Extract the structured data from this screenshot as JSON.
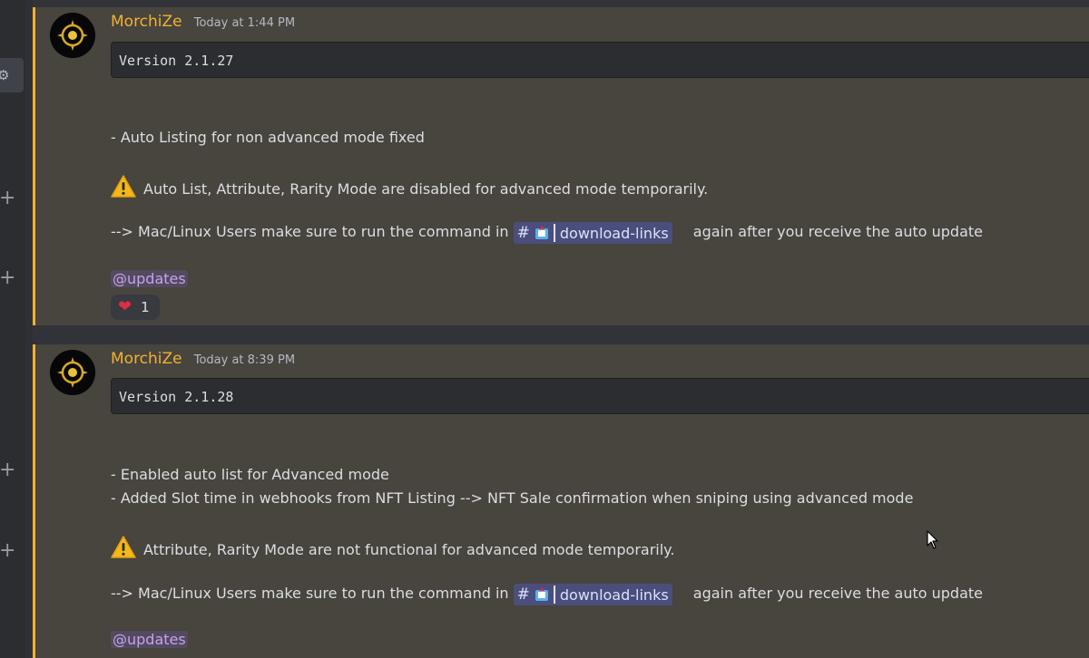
{
  "colors": {
    "accent_name": "#f0b232",
    "highlight_bg": "#48443e",
    "mention": "#c9a0f0",
    "channel_bg": "#4a4e7c"
  },
  "sidebar": {
    "icons": [
      "gear-icon",
      "plus-icon",
      "plus-icon",
      "plus-icon",
      "plus-icon"
    ]
  },
  "messages": [
    {
      "author": "MorchiZe",
      "timestamp": "Today at 1:44 PM",
      "code": "Version 2.1.27",
      "line1": "- Auto Listing for non advanced mode fixed",
      "warning": "Auto List, Attribute, Rarity Mode are disabled for advanced mode temporarily.",
      "cmd_prefix": "--> Mac/Linux Users make sure to run the command in",
      "channel": "download-links",
      "cmd_suffix": "again after you receive the auto update",
      "mention": "@updates",
      "reaction": {
        "emoji": "heart-icon",
        "count": "1"
      }
    },
    {
      "author": "MorchiZe",
      "timestamp": "Today at 8:39 PM",
      "code": "Version 2.1.28",
      "line1": "- Enabled auto list for Advanced mode",
      "line2": "- Added Slot time in webhooks from NFT Listing --> NFT Sale confirmation when sniping using advanced mode",
      "warning": "Attribute, Rarity Mode are not functional for advanced mode temporarily.",
      "cmd_prefix": "--> Mac/Linux Users make sure to run the command in",
      "channel": "download-links",
      "cmd_suffix": "again after you receive the auto update",
      "mention": "@updates"
    }
  ]
}
